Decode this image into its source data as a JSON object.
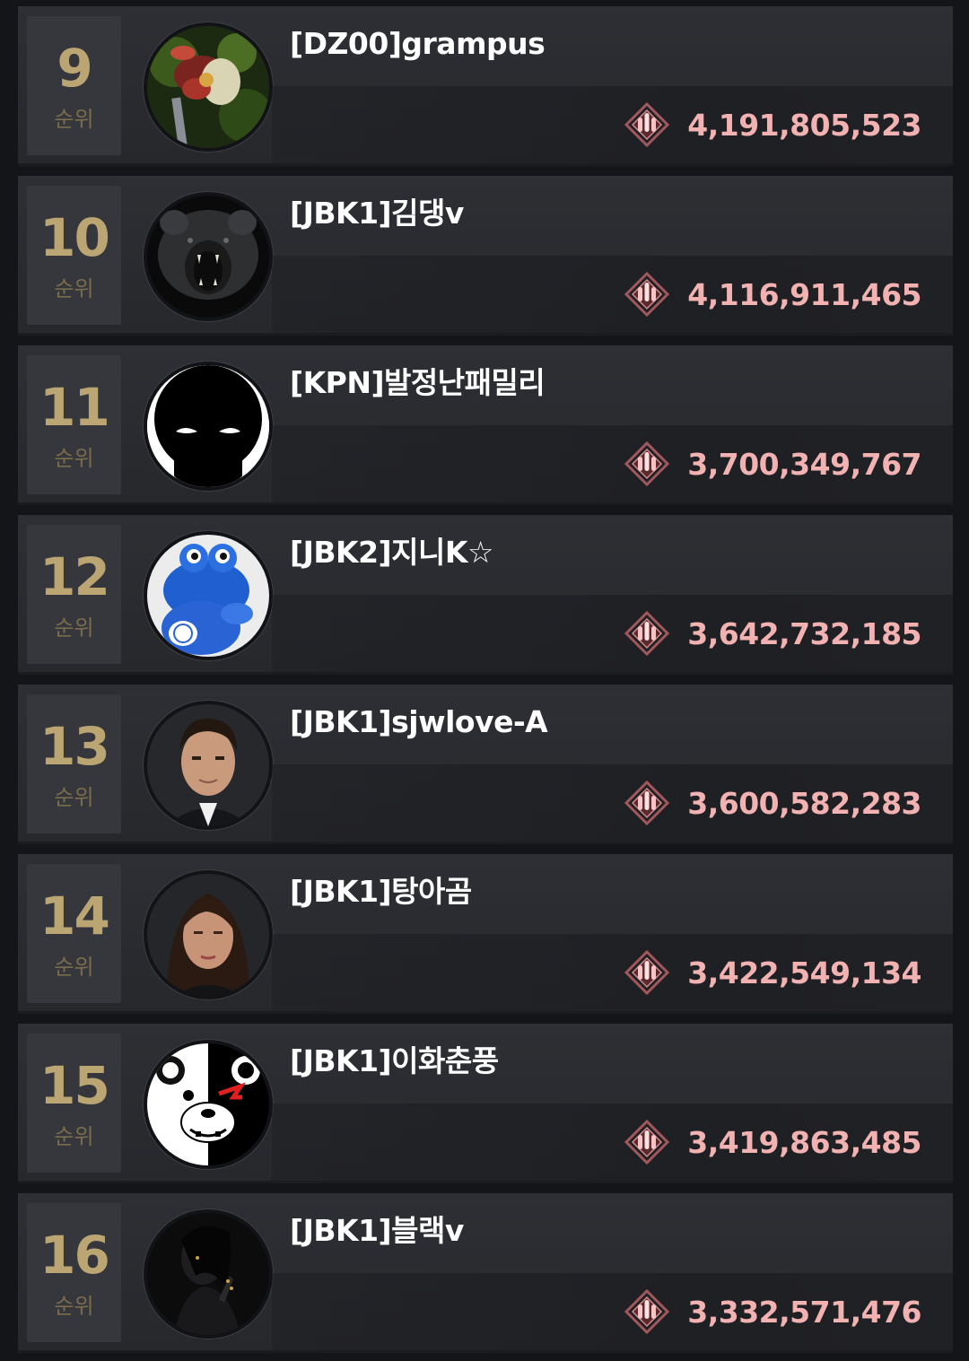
{
  "ranking": {
    "rank_suffix": "순위",
    "score_icon": "bullets-emblem-icon",
    "accent_color": "#bba572",
    "score_color": "#f2b2b2",
    "entries": [
      {
        "rank": "9",
        "name": "[DZ00]grampus",
        "score": "4,191,805,523",
        "avatar": "flower-avatar"
      },
      {
        "rank": "10",
        "name": "[JBK1]김댕v",
        "score": "4,116,911,465",
        "avatar": "roaring-bear-avatar"
      },
      {
        "rank": "11",
        "name": "[KPN]발정난패밀리",
        "score": "3,700,349,767",
        "avatar": "shadow-creature-avatar"
      },
      {
        "rank": "12",
        "name": "[JBK2]지니K☆",
        "score": "3,642,732,185",
        "avatar": "blue-frog-avatar"
      },
      {
        "rank": "13",
        "name": "[JBK1]sjwlove-A",
        "score": "3,600,582,283",
        "avatar": "man-in-suit-avatar"
      },
      {
        "rank": "14",
        "name": "[JBK1]탕아곰",
        "score": "3,422,549,134",
        "avatar": "woman-portrait-avatar"
      },
      {
        "rank": "15",
        "name": "[JBK1]이화춘풍",
        "score": "3,419,863,485",
        "avatar": "monokuma-bear-avatar"
      },
      {
        "rank": "16",
        "name": "[JBK1]블랙v",
        "score": "3,332,571,476",
        "avatar": "dark-figure-avatar"
      }
    ]
  }
}
